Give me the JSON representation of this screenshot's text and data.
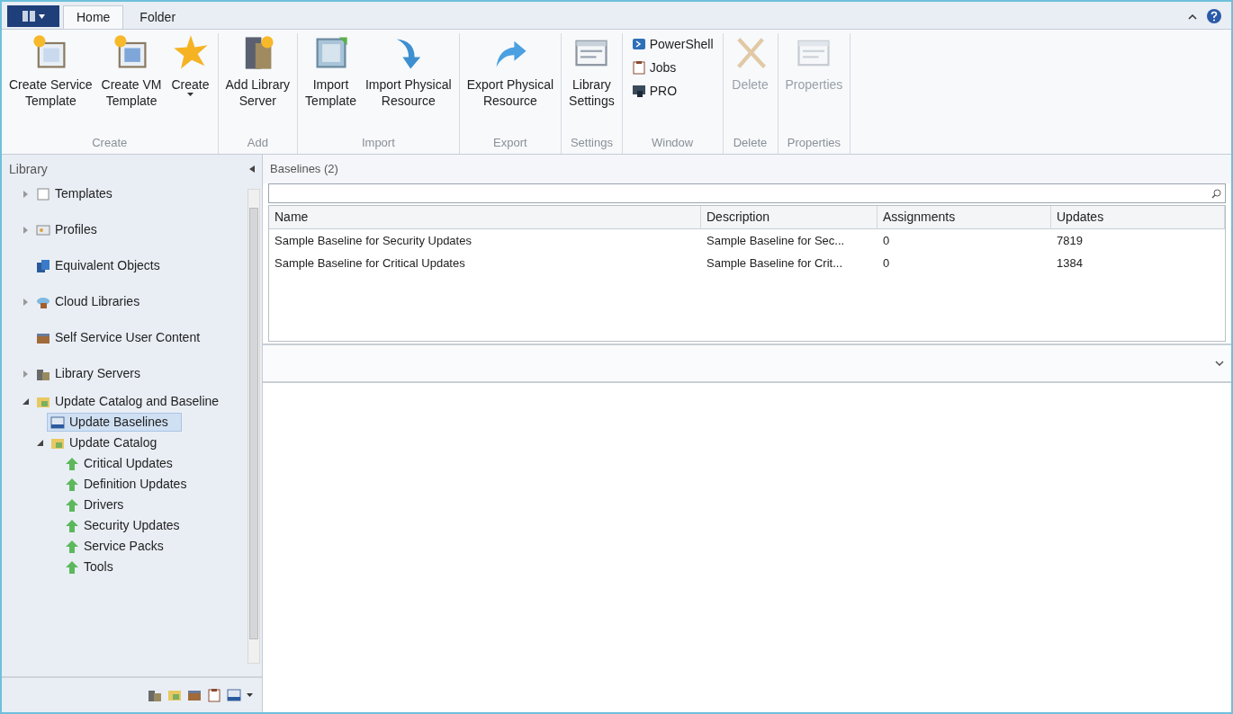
{
  "tabs": [
    {
      "label": "Home",
      "selected": true
    },
    {
      "label": "Folder",
      "selected": false
    }
  ],
  "ribbon": [
    {
      "label": "Create",
      "buttons": [
        {
          "label": "Create Service\nTemplate",
          "kind": "service-template",
          "disabled": false
        },
        {
          "label": "Create VM\nTemplate",
          "kind": "vm-template",
          "disabled": false
        },
        {
          "label": "Create",
          "kind": "star",
          "disabled": false,
          "dropdown": true
        }
      ]
    },
    {
      "label": "Add",
      "buttons": [
        {
          "label": "Add Library\nServer",
          "kind": "server",
          "disabled": false
        }
      ]
    },
    {
      "label": "Import",
      "buttons": [
        {
          "label": "Import\nTemplate",
          "kind": "import-template",
          "disabled": false
        },
        {
          "label": "Import Physical\nResource",
          "kind": "arrow-down",
          "disabled": false
        }
      ]
    },
    {
      "label": "Export",
      "buttons": [
        {
          "label": "Export Physical\nResource",
          "kind": "arrow-right",
          "disabled": false
        }
      ]
    },
    {
      "label": "Settings",
      "buttons": [
        {
          "label": "Library\nSettings",
          "kind": "window",
          "disabled": false
        }
      ]
    },
    {
      "label": "Window",
      "small": [
        {
          "label": "PowerShell",
          "kind": "powershell"
        },
        {
          "label": "Jobs",
          "kind": "clipboard"
        },
        {
          "label": "PRO",
          "kind": "pro"
        }
      ]
    },
    {
      "label": "Delete",
      "buttons": [
        {
          "label": "Delete",
          "kind": "cross",
          "disabled": true
        }
      ]
    },
    {
      "label": "Properties",
      "buttons": [
        {
          "label": "Properties",
          "kind": "window",
          "disabled": true
        }
      ]
    }
  ],
  "sidebar": {
    "title": "Library",
    "items": [
      {
        "label": "Templates",
        "kind": "page",
        "expanded": false,
        "selected": false
      },
      {
        "label": "Profiles",
        "kind": "profile",
        "expanded": false,
        "selected": false
      },
      {
        "label": "Equivalent Objects",
        "kind": "equivalent",
        "selected": false
      },
      {
        "label": "Cloud Libraries",
        "kind": "cloud",
        "expanded": false,
        "selected": false
      },
      {
        "label": "Self Service User Content",
        "kind": "box",
        "selected": false
      },
      {
        "label": "Library Servers",
        "kind": "servers",
        "expanded": false,
        "selected": false
      },
      {
        "label": "Update Catalog and Baseline",
        "kind": "folder",
        "expanded": true,
        "selected": false,
        "children": [
          {
            "label": "Update Baselines",
            "kind": "baseline",
            "selected": true
          },
          {
            "label": "Update Catalog",
            "kind": "folder",
            "expanded": true,
            "selected": false,
            "children": [
              {
                "label": "Critical Updates",
                "kind": "up-arrow",
                "selected": false
              },
              {
                "label": "Definition Updates",
                "kind": "up-arrow",
                "selected": false
              },
              {
                "label": "Drivers",
                "kind": "up-arrow",
                "selected": false
              },
              {
                "label": "Security Updates",
                "kind": "up-arrow",
                "selected": false
              },
              {
                "label": "Service Packs",
                "kind": "up-arrow",
                "selected": false
              },
              {
                "label": "Tools",
                "kind": "up-arrow",
                "selected": false
              }
            ]
          }
        ]
      }
    ]
  },
  "main": {
    "title": "Baselines (2)",
    "table": {
      "columns": [
        "Name",
        "Description",
        "Assignments",
        "Updates"
      ],
      "rows": [
        [
          "Sample Baseline for Security Updates",
          "Sample Baseline for Sec...",
          "0",
          "7819"
        ],
        [
          "Sample Baseline for Critical Updates",
          "Sample Baseline for Crit...",
          "0",
          "1384"
        ]
      ]
    }
  }
}
